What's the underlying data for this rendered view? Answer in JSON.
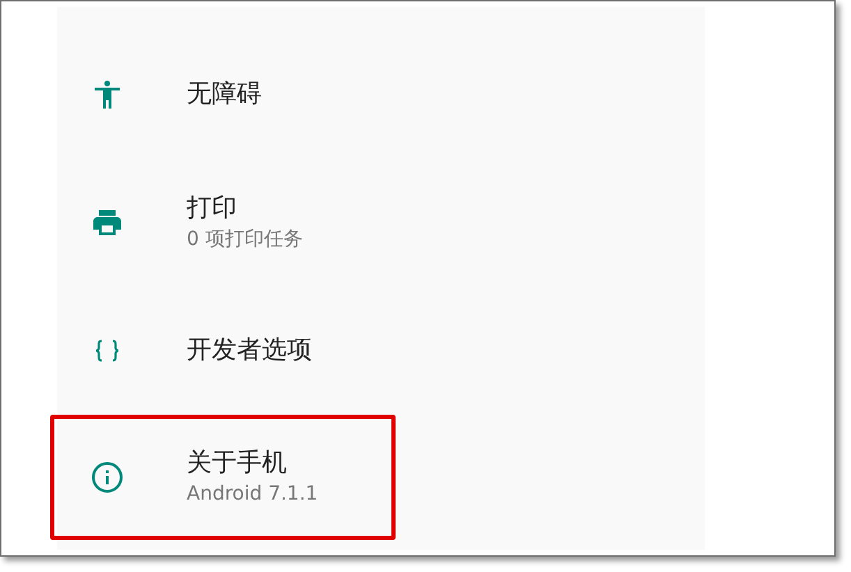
{
  "items": [
    {
      "kind": "accessibility",
      "title": "无障碍",
      "highlighted": false
    },
    {
      "kind": "print",
      "title": "打印",
      "subtitle": "0 项打印任务",
      "highlighted": false
    },
    {
      "kind": "developer",
      "title": "开发者选项",
      "highlighted": false
    },
    {
      "kind": "about",
      "title": "关于手机",
      "subtitle": "Android 7.1.1",
      "highlighted": true
    }
  ]
}
